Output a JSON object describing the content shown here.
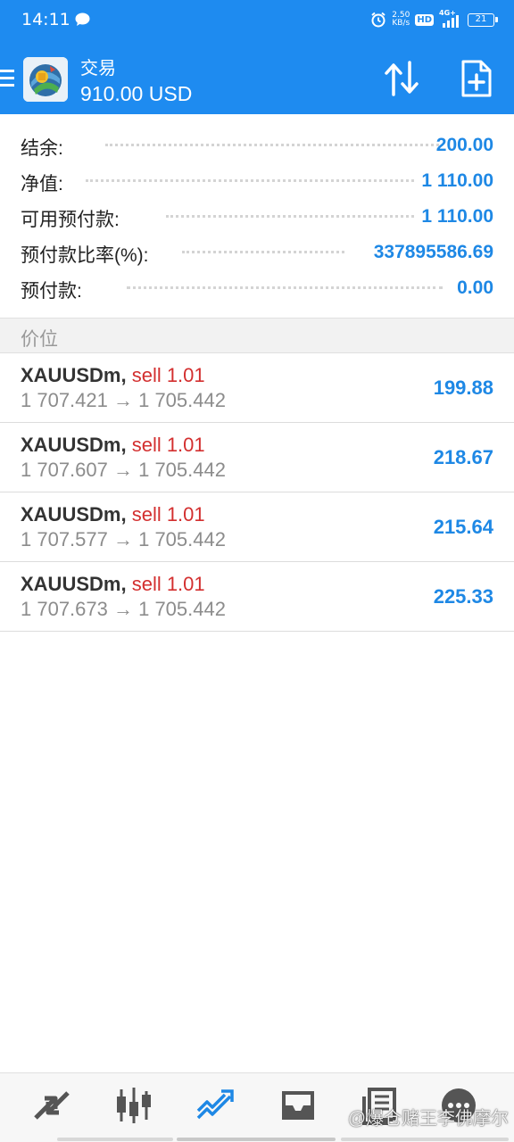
{
  "status_bar": {
    "time": "14:11",
    "net_speed_value": "2.50",
    "net_speed_unit": "KB/s",
    "hd": "HD",
    "network": "4G+",
    "battery": "21"
  },
  "app_bar": {
    "title": "交易",
    "subtitle": "910.00 USD"
  },
  "summary": [
    {
      "label": "结余:",
      "value": "200.00"
    },
    {
      "label": "净值:",
      "value": "1 110.00"
    },
    {
      "label": "可用预付款:",
      "value": "1 110.00"
    },
    {
      "label": "预付款比率(%):",
      "value": "337895586.69"
    },
    {
      "label": "预付款:",
      "value": "0.00"
    }
  ],
  "section_header": "价位",
  "positions": [
    {
      "symbol": "XAUUSDm,",
      "side": "sell 1.01",
      "prices": "1 707.421 → 1 705.442",
      "profit": "199.88"
    },
    {
      "symbol": "XAUUSDm,",
      "side": "sell 1.01",
      "prices": "1 707.607 → 1 705.442",
      "profit": "218.67"
    },
    {
      "symbol": "XAUUSDm,",
      "side": "sell 1.01",
      "prices": "1 707.577 → 1 705.442",
      "profit": "215.64"
    },
    {
      "symbol": "XAUUSDm,",
      "side": "sell 1.01",
      "prices": "1 707.673 → 1 705.442",
      "profit": "225.33"
    }
  ],
  "bottom_nav": [
    {
      "icon": "quotes-arrows-icon",
      "active": false
    },
    {
      "icon": "candlestick-chart-icon",
      "active": false
    },
    {
      "icon": "trade-trend-icon",
      "active": true
    },
    {
      "icon": "history-inbox-icon",
      "active": false
    },
    {
      "icon": "news-document-icon",
      "active": false
    },
    {
      "icon": "messages-chat-icon",
      "active": false
    }
  ],
  "watermark": "@爆仓赌王李佛摩尔",
  "colors": {
    "primary": "#1e8bf0",
    "value_blue": "#1e88e5",
    "sell_red": "#d32f2f",
    "muted_gray": "#8c8c8c",
    "nav_icon": "#555555"
  }
}
